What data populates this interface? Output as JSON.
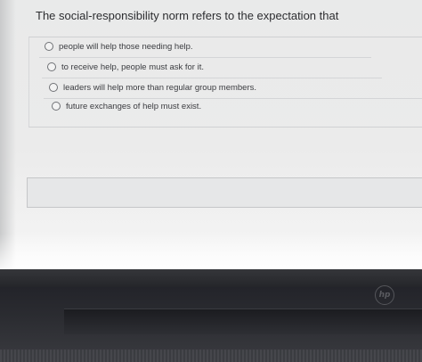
{
  "question": {
    "text": "The social-responsibility norm refers to the expectation that"
  },
  "options": [
    {
      "label": "people will help those needing help.",
      "selected": false
    },
    {
      "label": "to receive help, people must ask for it.",
      "selected": false
    },
    {
      "label": "leaders will help more than regular group members.",
      "selected": false
    },
    {
      "label": "future exchanges of help must exist.",
      "selected": false
    }
  ],
  "device": {
    "logo_text": "hp"
  }
}
